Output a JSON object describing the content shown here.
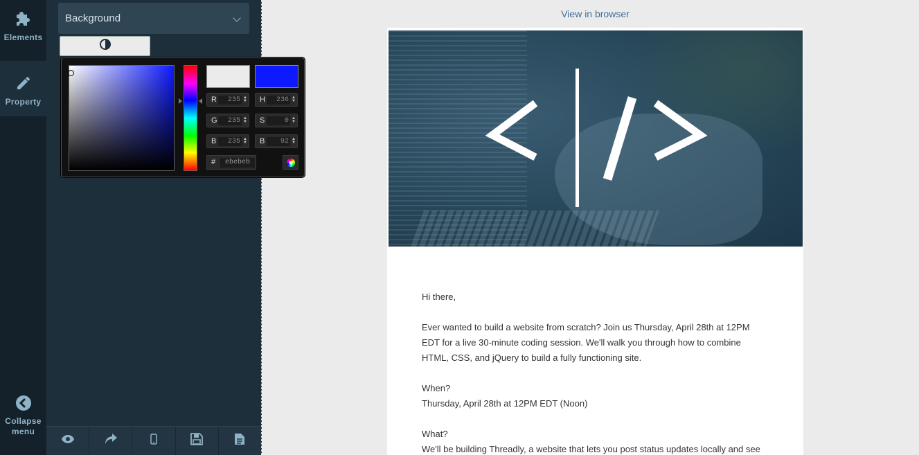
{
  "rail": {
    "elements_label": "Elements",
    "property_label": "Property",
    "collapse_label_line1": "Collapse",
    "collapse_label_line2": "menu"
  },
  "panel": {
    "background_select_value": "Background",
    "bottom_actions": [
      "preview-eye-icon",
      "redo-icon",
      "mobile-icon",
      "save-icon",
      "document-icon"
    ]
  },
  "color_picker": {
    "current_color": "#ebebeb",
    "new_color": "#0d1aff",
    "fields": {
      "r_label": "R",
      "r_value": "235",
      "g_label": "G",
      "g_value": "235",
      "b_label": "B",
      "b_value": "235",
      "h_label": "H",
      "h_value": "236",
      "s_label": "S",
      "s_value": "0",
      "bv_label": "B",
      "bv_value": "92"
    },
    "hex_label": "#",
    "hex_value": "ebebeb"
  },
  "email": {
    "view_in_browser": "View in browser",
    "hero_alt": "code-hero-image",
    "greeting": "Hi there,",
    "intro": "Ever wanted to build a website from scratch? Join us Thursday, April 28th at 12PM EDT for a live 30-minute coding session. We'll walk you through how to combine HTML, CSS, and jQuery to build a fully functioning site.",
    "when_heading": "When?",
    "when_text": "Thursday, April 28th at 12PM EDT (Noon)",
    "what_heading": "What?",
    "what_text": "We'll be building Threadly, a website that lets you post status updates locally and see"
  }
}
